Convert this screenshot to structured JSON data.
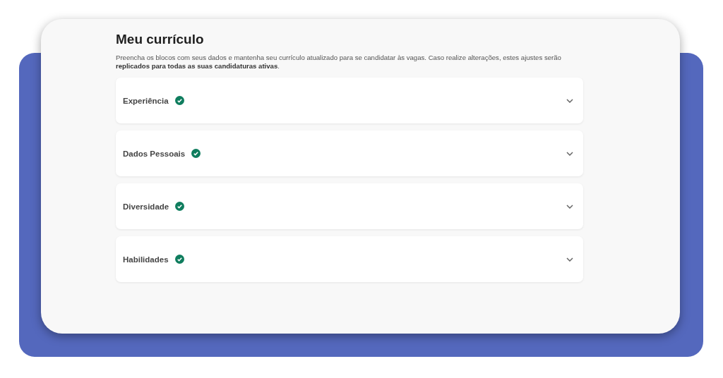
{
  "title": "Meu currículo",
  "intro": "Preencha os blocos com seus dados e mantenha seu currículo atualizado para se candidatar às vagas. Caso realize alterações, estes ajustes serão **replicados para todas as suas candidaturas ativas**.",
  "sections": [
    {
      "label": "Experiência",
      "completed": true,
      "expanded": false
    },
    {
      "label": "Dados Pessoais",
      "completed": true,
      "expanded": false
    },
    {
      "label": "Diversidade",
      "completed": true,
      "expanded": false
    },
    {
      "label": "Habilidades",
      "completed": true,
      "expanded": false
    }
  ]
}
